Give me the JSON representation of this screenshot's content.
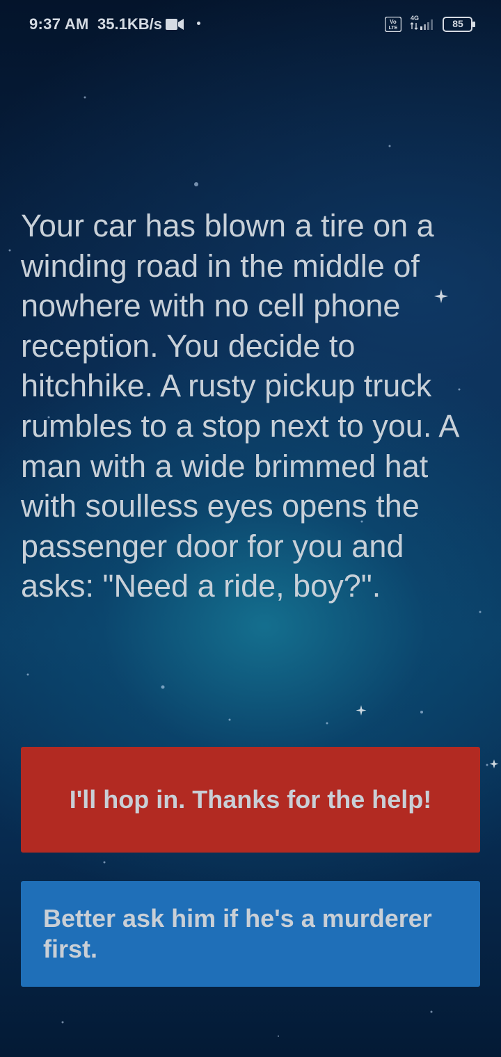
{
  "status_bar": {
    "time": "9:37 AM",
    "network_speed": "35.1KB/s",
    "video_icon": "video-camera-icon",
    "volte_badge": "Vo LTE",
    "network_type": "4G",
    "battery_level": "85"
  },
  "story": {
    "text": "Your car has blown a tire on a winding road in the middle of nowhere with no cell phone reception. You decide to hitchhike. A rusty pickup truck rumbles to a stop next to you. A man with a wide brimmed hat with soulless eyes opens the passenger door for you and asks: \"Need a ride, boy?\"."
  },
  "choices": [
    {
      "label": "I'll hop in. Thanks for the help!",
      "color": "#b22a22"
    },
    {
      "label": "Better ask him if he's a murderer first.",
      "color": "#1f6fb8"
    }
  ],
  "colors": {
    "background": "#061a33",
    "text": "#c8d0d8"
  }
}
